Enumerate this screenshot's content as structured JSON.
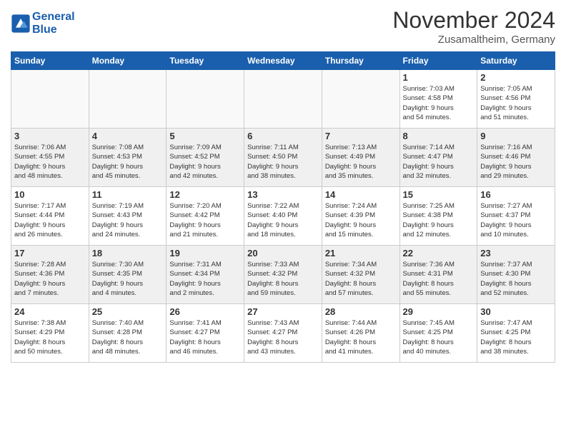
{
  "header": {
    "logo_line1": "General",
    "logo_line2": "Blue",
    "title": "November 2024",
    "location": "Zusamaltheim, Germany"
  },
  "days_of_week": [
    "Sunday",
    "Monday",
    "Tuesday",
    "Wednesday",
    "Thursday",
    "Friday",
    "Saturday"
  ],
  "weeks": [
    [
      {
        "day": "",
        "info": "",
        "empty": true
      },
      {
        "day": "",
        "info": "",
        "empty": true
      },
      {
        "day": "",
        "info": "",
        "empty": true
      },
      {
        "day": "",
        "info": "",
        "empty": true
      },
      {
        "day": "",
        "info": "",
        "empty": true
      },
      {
        "day": "1",
        "info": "Sunrise: 7:03 AM\nSunset: 4:58 PM\nDaylight: 9 hours\nand 54 minutes.",
        "empty": false
      },
      {
        "day": "2",
        "info": "Sunrise: 7:05 AM\nSunset: 4:56 PM\nDaylight: 9 hours\nand 51 minutes.",
        "empty": false
      }
    ],
    [
      {
        "day": "3",
        "info": "Sunrise: 7:06 AM\nSunset: 4:55 PM\nDaylight: 9 hours\nand 48 minutes.",
        "empty": false
      },
      {
        "day": "4",
        "info": "Sunrise: 7:08 AM\nSunset: 4:53 PM\nDaylight: 9 hours\nand 45 minutes.",
        "empty": false
      },
      {
        "day": "5",
        "info": "Sunrise: 7:09 AM\nSunset: 4:52 PM\nDaylight: 9 hours\nand 42 minutes.",
        "empty": false
      },
      {
        "day": "6",
        "info": "Sunrise: 7:11 AM\nSunset: 4:50 PM\nDaylight: 9 hours\nand 38 minutes.",
        "empty": false
      },
      {
        "day": "7",
        "info": "Sunrise: 7:13 AM\nSunset: 4:49 PM\nDaylight: 9 hours\nand 35 minutes.",
        "empty": false
      },
      {
        "day": "8",
        "info": "Sunrise: 7:14 AM\nSunset: 4:47 PM\nDaylight: 9 hours\nand 32 minutes.",
        "empty": false
      },
      {
        "day": "9",
        "info": "Sunrise: 7:16 AM\nSunset: 4:46 PM\nDaylight: 9 hours\nand 29 minutes.",
        "empty": false
      }
    ],
    [
      {
        "day": "10",
        "info": "Sunrise: 7:17 AM\nSunset: 4:44 PM\nDaylight: 9 hours\nand 26 minutes.",
        "empty": false
      },
      {
        "day": "11",
        "info": "Sunrise: 7:19 AM\nSunset: 4:43 PM\nDaylight: 9 hours\nand 24 minutes.",
        "empty": false
      },
      {
        "day": "12",
        "info": "Sunrise: 7:20 AM\nSunset: 4:42 PM\nDaylight: 9 hours\nand 21 minutes.",
        "empty": false
      },
      {
        "day": "13",
        "info": "Sunrise: 7:22 AM\nSunset: 4:40 PM\nDaylight: 9 hours\nand 18 minutes.",
        "empty": false
      },
      {
        "day": "14",
        "info": "Sunrise: 7:24 AM\nSunset: 4:39 PM\nDaylight: 9 hours\nand 15 minutes.",
        "empty": false
      },
      {
        "day": "15",
        "info": "Sunrise: 7:25 AM\nSunset: 4:38 PM\nDaylight: 9 hours\nand 12 minutes.",
        "empty": false
      },
      {
        "day": "16",
        "info": "Sunrise: 7:27 AM\nSunset: 4:37 PM\nDaylight: 9 hours\nand 10 minutes.",
        "empty": false
      }
    ],
    [
      {
        "day": "17",
        "info": "Sunrise: 7:28 AM\nSunset: 4:36 PM\nDaylight: 9 hours\nand 7 minutes.",
        "empty": false
      },
      {
        "day": "18",
        "info": "Sunrise: 7:30 AM\nSunset: 4:35 PM\nDaylight: 9 hours\nand 4 minutes.",
        "empty": false
      },
      {
        "day": "19",
        "info": "Sunrise: 7:31 AM\nSunset: 4:34 PM\nDaylight: 9 hours\nand 2 minutes.",
        "empty": false
      },
      {
        "day": "20",
        "info": "Sunrise: 7:33 AM\nSunset: 4:32 PM\nDaylight: 8 hours\nand 59 minutes.",
        "empty": false
      },
      {
        "day": "21",
        "info": "Sunrise: 7:34 AM\nSunset: 4:32 PM\nDaylight: 8 hours\nand 57 minutes.",
        "empty": false
      },
      {
        "day": "22",
        "info": "Sunrise: 7:36 AM\nSunset: 4:31 PM\nDaylight: 8 hours\nand 55 minutes.",
        "empty": false
      },
      {
        "day": "23",
        "info": "Sunrise: 7:37 AM\nSunset: 4:30 PM\nDaylight: 8 hours\nand 52 minutes.",
        "empty": false
      }
    ],
    [
      {
        "day": "24",
        "info": "Sunrise: 7:38 AM\nSunset: 4:29 PM\nDaylight: 8 hours\nand 50 minutes.",
        "empty": false
      },
      {
        "day": "25",
        "info": "Sunrise: 7:40 AM\nSunset: 4:28 PM\nDaylight: 8 hours\nand 48 minutes.",
        "empty": false
      },
      {
        "day": "26",
        "info": "Sunrise: 7:41 AM\nSunset: 4:27 PM\nDaylight: 8 hours\nand 46 minutes.",
        "empty": false
      },
      {
        "day": "27",
        "info": "Sunrise: 7:43 AM\nSunset: 4:27 PM\nDaylight: 8 hours\nand 43 minutes.",
        "empty": false
      },
      {
        "day": "28",
        "info": "Sunrise: 7:44 AM\nSunset: 4:26 PM\nDaylight: 8 hours\nand 41 minutes.",
        "empty": false
      },
      {
        "day": "29",
        "info": "Sunrise: 7:45 AM\nSunset: 4:25 PM\nDaylight: 8 hours\nand 40 minutes.",
        "empty": false
      },
      {
        "day": "30",
        "info": "Sunrise: 7:47 AM\nSunset: 4:25 PM\nDaylight: 8 hours\nand 38 minutes.",
        "empty": false
      }
    ]
  ]
}
